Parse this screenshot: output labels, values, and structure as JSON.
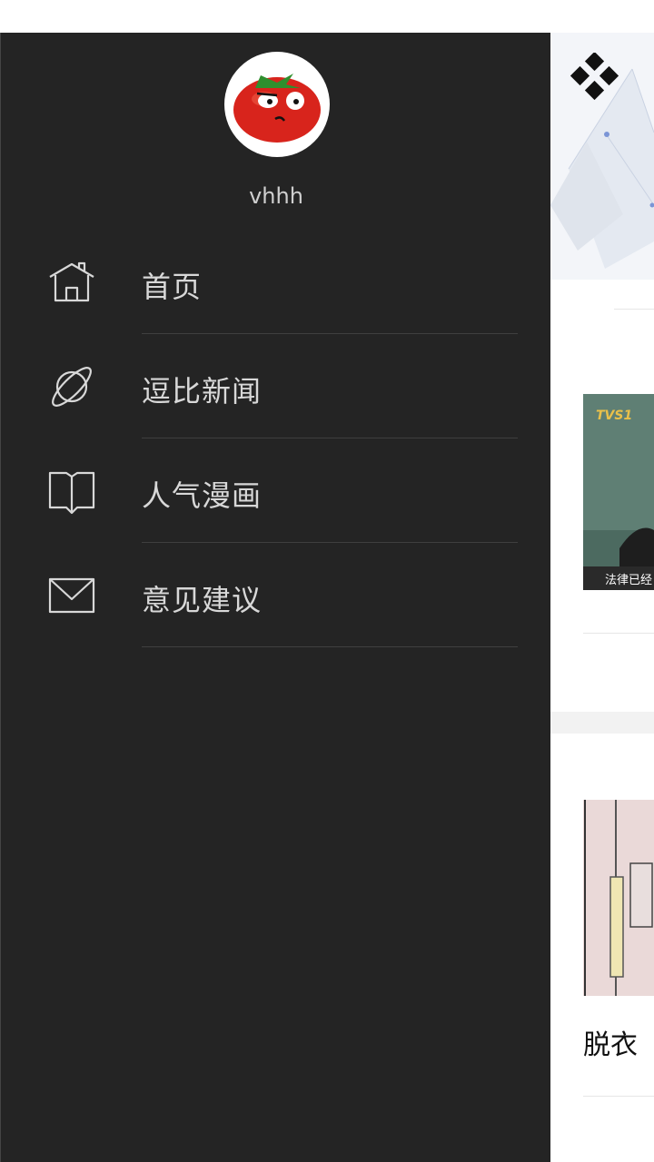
{
  "drawer": {
    "username": "vhhh",
    "items": [
      {
        "label": "首页",
        "icon": "home-icon"
      },
      {
        "label": "逗比新闻",
        "icon": "planet-icon"
      },
      {
        "label": "人气漫画",
        "icon": "book-icon"
      },
      {
        "label": "意见建议",
        "icon": "mail-icon"
      }
    ]
  },
  "main": {
    "thumbnail1_caption": "法律已经",
    "thumbnail1_logo": "TVS1",
    "card2_title": "脱衣"
  },
  "colors": {
    "drawer_bg": "#242424",
    "drawer_text": "#d8d8d8",
    "divider": "#3f3f3f",
    "page_bg": "#ffffff"
  }
}
